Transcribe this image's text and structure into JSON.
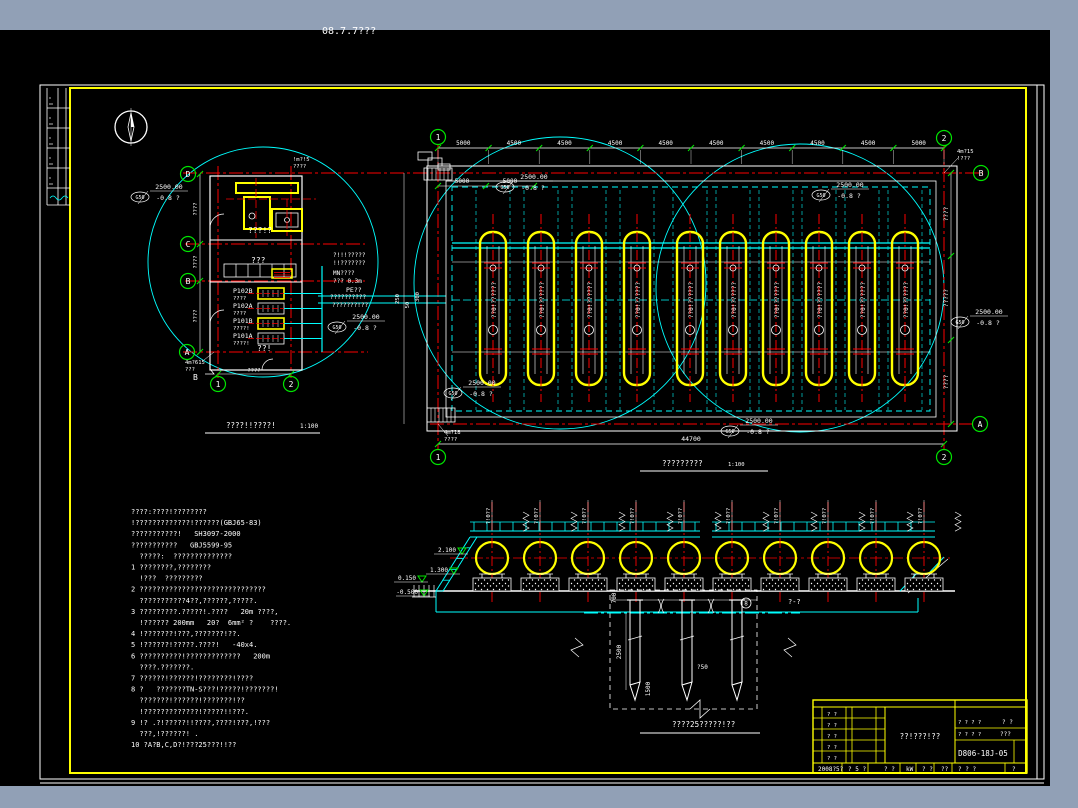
{
  "colors": {
    "backdrop": "#91a0b6",
    "canvas": "#000000",
    "white": "#ffffff",
    "yellow": "#ffff00",
    "cyan": "#00ffff",
    "red": "#fb0000",
    "green": "#00e400"
  },
  "top_label": "08.7.7???",
  "building": {
    "room_labels": [
      "???!?",
      "???",
      "??!"
    ],
    "equipment": [
      [
        "P102B",
        "????"
      ],
      [
        "P102A",
        "????"
      ],
      [
        "P101B",
        "????!"
      ],
      [
        "P101A",
        "????!"
      ]
    ],
    "axis_left": [
      "D",
      "C",
      "B",
      "A"
    ],
    "axis_bottom": [
      "1",
      "2"
    ],
    "section_mark": "B",
    "dims_left": [
      "????",
      "????",
      "????"
    ],
    "dim_bottom": "????",
    "leader_bl": [
      "4m?615",
      "???"
    ],
    "leader_tr": [
      "!m?!5",
      "????"
    ],
    "caption": "????!!????!",
    "caption_scale": "1:100"
  },
  "yard": {
    "bubble_top_left": "1",
    "bubble_top_right": "2",
    "bubble_right_top": "B",
    "bubble_right_bottom": "A",
    "bubble_bottom_right": "2",
    "bubble_bottom_left": "1",
    "dims_top": [
      "5000",
      "4500",
      "4500",
      "4500",
      "4500",
      "4500",
      "4500",
      "4500",
      "4500",
      "5000"
    ],
    "dims_inner": [
      "5000",
      "5000"
    ],
    "dim_bottom": "44700",
    "dims_right": [
      "????",
      "?????",
      "????"
    ],
    "dims_left_small": [
      "250",
      "50",
      "300"
    ],
    "callout": {
      "prefix": "G50",
      "value": "2500.00",
      "offset": "-0.8 ?"
    },
    "tank_label": "??0!??????",
    "info_cyan": [
      "?!!!?????",
      "!!???????",
      "??????????",
      "???????!??"
    ],
    "info_red": [
      "MN????",
      "??? 0.3m"
    ],
    "pe_label": "PE??",
    "leader_tr": [
      "4m?15",
      "!???"
    ],
    "leader_bl": [
      "4m?18",
      "????"
    ],
    "caption": "?????????",
    "caption_scale": "1:100"
  },
  "elevation": {
    "markers": [
      "2.100",
      "1.300",
      "0.150",
      "-0.500"
    ],
    "tank_label": "?!0??"
  },
  "detail": {
    "dim_depth": "700",
    "dim_length": "2500",
    "dim_spacing": "1500",
    "dim_dia": "?50",
    "circle_label": "8",
    "section_label": "?-?",
    "caption": "????25?????!??"
  },
  "notes": {
    "lines": [
      "????:????!????????",
      "!?????????????!??????(GBJ65-83)",
      "???????????!   SH3097-2000",
      "???????????   GBJ5599-95",
      "  ?????:  ??????????????",
      "1 ????????,????????",
      "  !???  ?????????",
      "2 ??????????????????????????????",
      "  ???????????4??,??????,?????.",
      "3 ?????????.?????!.????   20m ????,",
      "  !?????? 200mm   20?  6mm² ?    ????.",
      "4 !???????!???,???????!??.",
      "5 !??????!?????.????!   -40x4.",
      "6 ??????????!?????????????   200m",
      "  ????.???????.",
      "7 ??????!??????!????????!????",
      "8 ?   ???????TN-S???!?????!???????!",
      "  ???????!??????!???????!??",
      "  !?????????????!?????!!???.",
      "9 !? .?!?????!!????,????!???,!???",
      "  ???,!??????! .",
      "10 ?A?B,C,D?!???25???!!??"
    ]
  },
  "title_block": {
    "title": "??!???!??",
    "drawing_no": "D806-18J-05",
    "left_rows": [
      "? ?",
      "? ?",
      "? ?",
      "? ?",
      "? ?"
    ],
    "right_row1_ticks": "? ? ? ?",
    "right_row1_value": "? ?",
    "right_row2_ticks": "? ? ? ?",
    "right_row2_value": "???",
    "bottom_cells": [
      "2008?5?",
      "? 5 ?",
      "? ?",
      "kW",
      "? ?",
      "??",
      "? ? ?",
      "?"
    ]
  }
}
